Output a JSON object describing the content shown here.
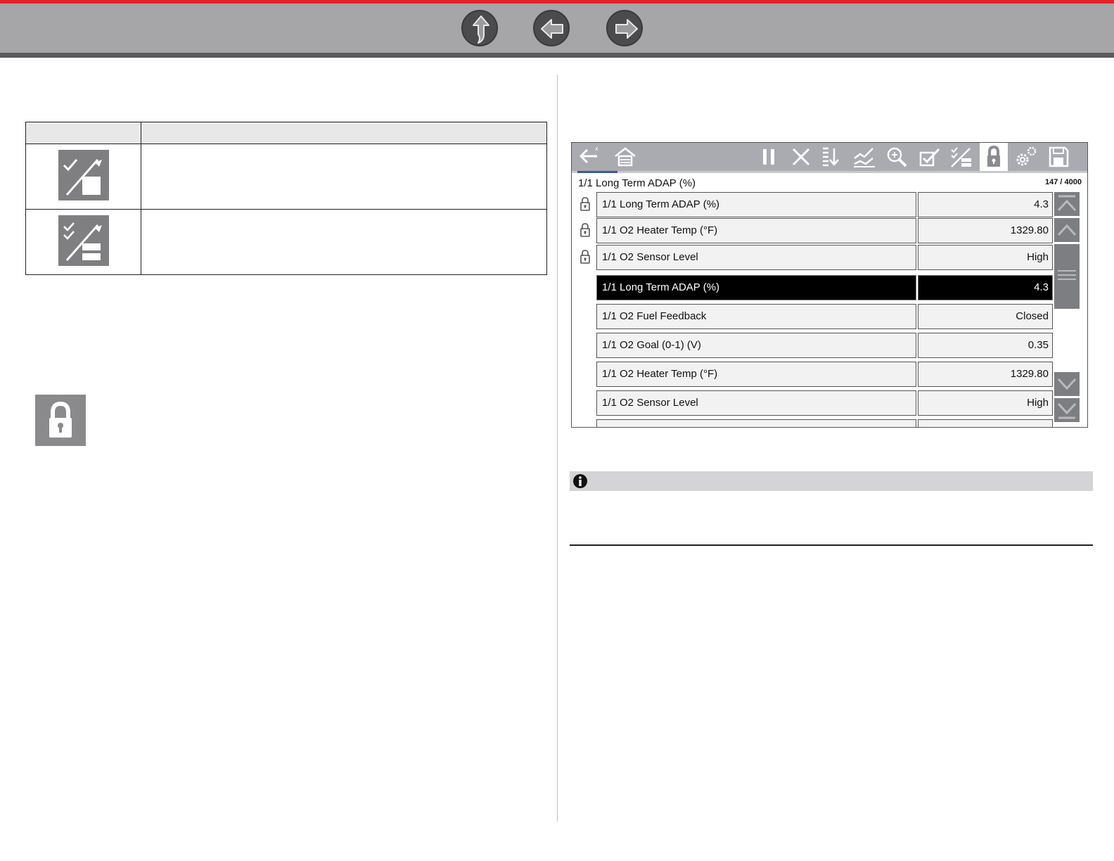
{
  "nav": {
    "home_icon": "up-arrow-icon",
    "back_icon": "left-arrow-icon",
    "forward_icon": "right-arrow-icon"
  },
  "icon_table": {
    "rows": [
      {
        "icon": "unlock-all-icon"
      },
      {
        "icon": "unlock-all-multi-icon"
      }
    ]
  },
  "lock_icon": "lock-icon",
  "device": {
    "toolbar_icons": [
      "back-icon",
      "home-icon",
      "pause-icon",
      "close-icon",
      "sort-icon",
      "graph-icon",
      "zoom-icon",
      "select-icon",
      "deselect-icon",
      "lock-icon",
      "settings-icon",
      "save-icon"
    ],
    "header_title": "1/1 Long Term ADAP (%)",
    "header_count": "147 / 4000",
    "locked_rows": [
      {
        "name": "1/1 Long Term ADAP (%)",
        "value": "4.3"
      },
      {
        "name": "1/1 O2 Heater Temp (°F)",
        "value": "1329.80"
      },
      {
        "name": "1/1 O2 Sensor Level",
        "value": "High"
      }
    ],
    "rows": [
      {
        "name": "1/1 Long Term ADAP (%)",
        "value": "4.3"
      },
      {
        "name": "1/1 O2 Fuel Feedback",
        "value": "Closed"
      },
      {
        "name": "1/1 O2 Goal (0-1) (V)",
        "value": "0.35"
      },
      {
        "name": "1/1 O2 Heater Temp (°F)",
        "value": "1329.80"
      },
      {
        "name": "1/1 O2 Sensor Level",
        "value": "High"
      }
    ]
  },
  "note": {
    "icon": "info-icon"
  }
}
